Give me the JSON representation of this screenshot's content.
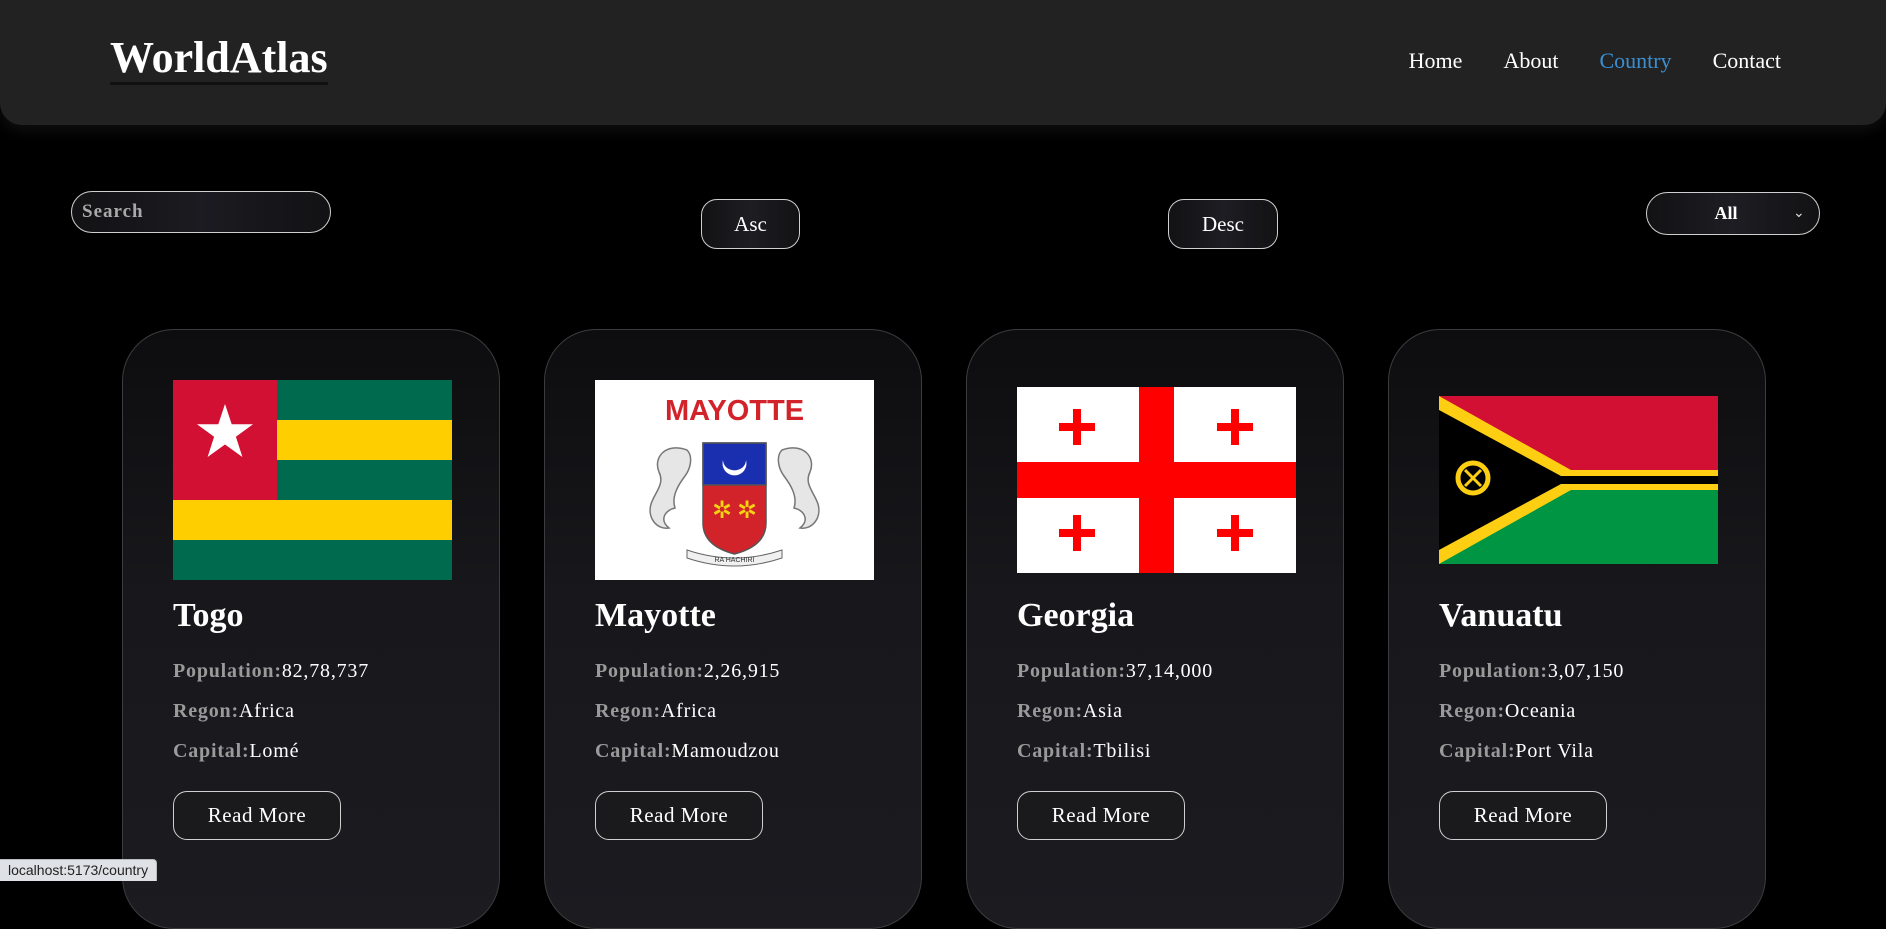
{
  "header": {
    "logo": "WorldAtlas",
    "nav": [
      {
        "label": "Home"
      },
      {
        "label": "About"
      },
      {
        "label": "Country",
        "active": true
      },
      {
        "label": "Contact"
      }
    ]
  },
  "controls": {
    "search_placeholder": "Search",
    "asc_label": "Asc",
    "desc_label": "Desc",
    "region_filter_value": "All"
  },
  "card_labels": {
    "population": "Population:",
    "region": "Regon:",
    "capital": "Capital:",
    "read_more": "Read More"
  },
  "countries": [
    {
      "name": "Togo",
      "population": "82,78,737",
      "region": "Africa",
      "capital": "Lomé"
    },
    {
      "name": "Mayotte",
      "population": "2,26,915",
      "region": "Africa",
      "capital": "Mamoudzou",
      "flag_text": "MAYOTTE",
      "motto": "RA HACHIRI"
    },
    {
      "name": "Georgia",
      "population": "37,14,000",
      "region": "Asia",
      "capital": "Tbilisi"
    },
    {
      "name": "Vanuatu",
      "population": "3,07,150",
      "region": "Oceania",
      "capital": "Port Vila"
    }
  ],
  "status_bar": {
    "url": "localhost:5173/country"
  },
  "colors": {
    "active_nav": "#3b8fd1",
    "background": "#000000",
    "header": "#222223"
  }
}
